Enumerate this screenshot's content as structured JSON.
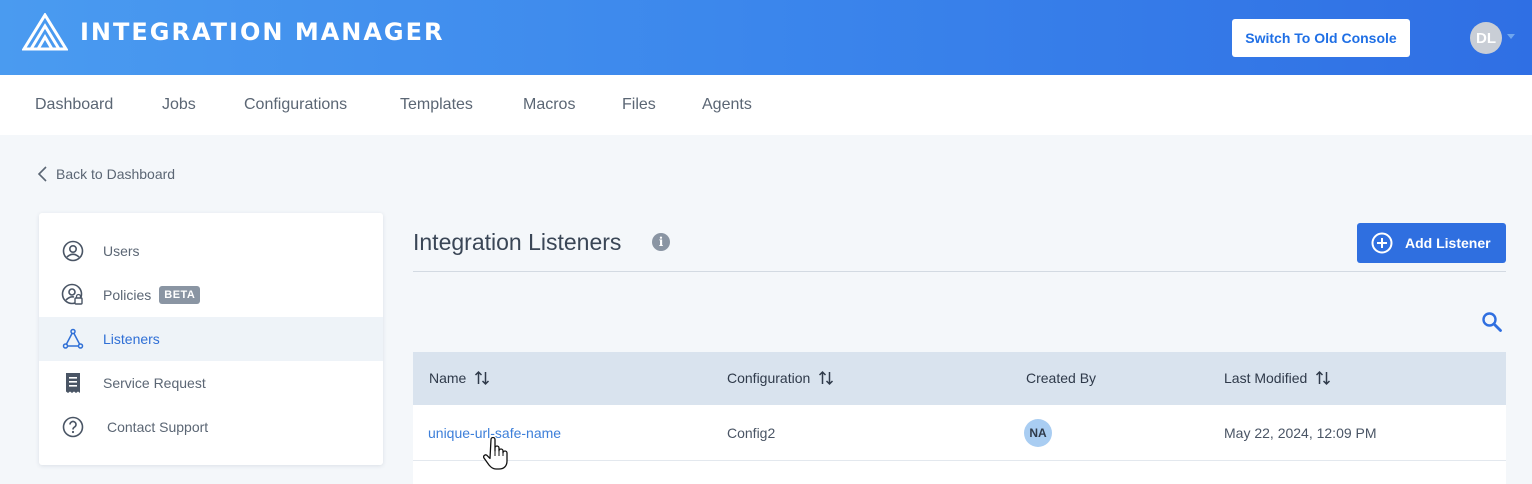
{
  "header": {
    "brand": "INTEGRATION MANAGER",
    "switch_button": "Switch To Old Console",
    "user_initials": "DL"
  },
  "nav": {
    "items": [
      "Dashboard",
      "Jobs",
      "Configurations",
      "Templates",
      "Macros",
      "Files",
      "Agents"
    ]
  },
  "back_link": "Back to Dashboard",
  "sidebar": {
    "items": [
      {
        "label": "Users",
        "icon": "user-circle-icon"
      },
      {
        "label": "Policies",
        "icon": "user-lock-icon",
        "badge": "BETA"
      },
      {
        "label": "Listeners",
        "icon": "listener-icon",
        "active": true
      },
      {
        "label": "Service Request",
        "icon": "receipt-icon"
      },
      {
        "label": "Contact Support",
        "icon": "question-circle-icon"
      }
    ]
  },
  "main": {
    "title": "Integration Listeners",
    "add_button": "Add Listener",
    "table": {
      "headers": [
        "Name",
        "Configuration",
        "Created By",
        "Last Modified"
      ],
      "rows": [
        {
          "name": "unique-url-safe-name",
          "configuration": "Config2",
          "created_by": "NA",
          "last_modified": "May 22, 2024, 12:09 PM"
        }
      ]
    }
  },
  "colors": {
    "header_gradient_start": "#4a9bf0",
    "header_gradient_end": "#2f6fe4",
    "primary_button": "#2f6fe0",
    "link": "#3d7fd9",
    "active_sidebar": "#2f6fd6"
  }
}
